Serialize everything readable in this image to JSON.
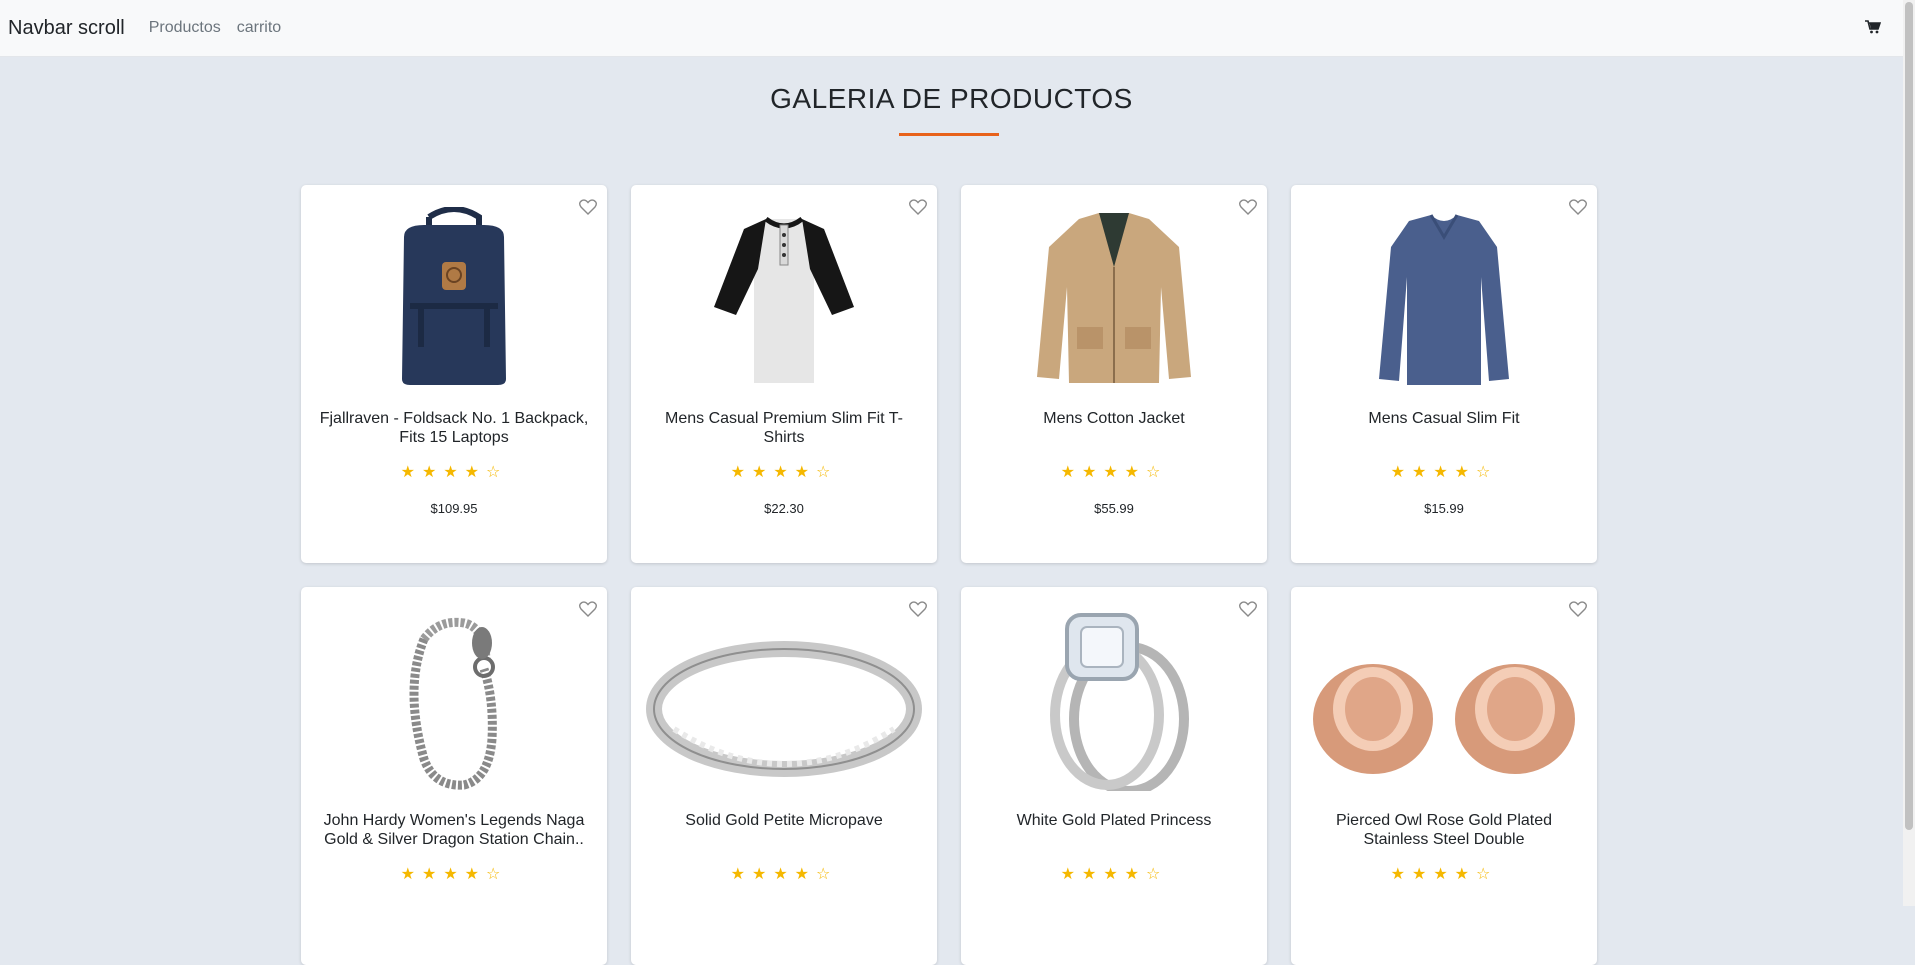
{
  "navbar": {
    "brand": "Navbar scroll",
    "links": [
      "Productos",
      "carrito"
    ],
    "cart_icon": "shopping-cart-icon"
  },
  "page_title": "GALERIA DE PRODUCTOS",
  "accent_color": "#e8621b",
  "star_color": "#f5b800",
  "products": [
    {
      "name": "Fjallraven - Foldsack No. 1 Backpack, Fits 15 Laptops",
      "price": "$109.95",
      "rating": 4,
      "image": "backpack"
    },
    {
      "name": "Mens Casual Premium Slim Fit T-Shirts",
      "price": "$22.30",
      "rating": 4,
      "image": "tshirt"
    },
    {
      "name": "Mens Cotton Jacket",
      "price": "$55.99",
      "rating": 4,
      "image": "jacket"
    },
    {
      "name": "Mens Casual Slim Fit",
      "price": "$15.99",
      "rating": 4,
      "image": "longsleeve"
    },
    {
      "name": "John Hardy Women's Legends Naga Gold & Silver Dragon Station Chain..",
      "price": "",
      "rating": 4,
      "image": "bracelet"
    },
    {
      "name": "Solid Gold Petite Micropave",
      "price": "",
      "rating": 4,
      "image": "band-ring"
    },
    {
      "name": "White Gold Plated Princess",
      "price": "",
      "rating": 4,
      "image": "diamond-ring"
    },
    {
      "name": "Pierced Owl Rose Gold Plated Stainless Steel Double",
      "price": "",
      "rating": 4,
      "image": "plugs"
    }
  ]
}
